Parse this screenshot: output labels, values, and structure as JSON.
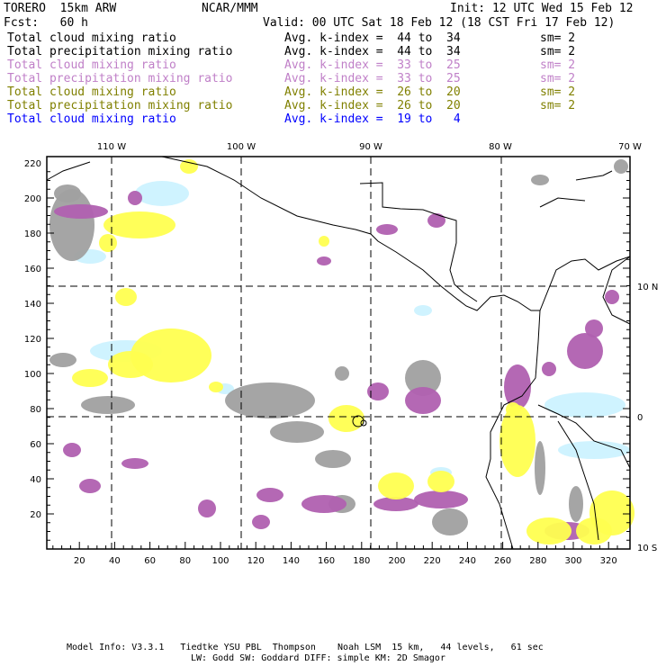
{
  "header": {
    "model": "TORERO  15km ARW",
    "org": "NCAR/MMM",
    "init": "Init: 12 UTC Wed 15 Feb 12",
    "fcst": "Fcst:   60 h",
    "valid": "Valid: 00 UTC Sat 18 Feb 12 (18 CST Fri 17 Feb 12)"
  },
  "legend": [
    {
      "field": "Total cloud mixing ratio",
      "range": "Avg. k-index =  44 to  34",
      "sm": "sm= 2",
      "color": "#000000"
    },
    {
      "field": "Total precipitation mixing ratio",
      "range": "Avg. k-index =  44 to  34",
      "sm": "sm= 2",
      "color": "#000000"
    },
    {
      "field": "Total cloud mixing ratio",
      "range": "Avg. k-index =  33 to  25",
      "sm": "sm= 2",
      "color": "#c080c8"
    },
    {
      "field": "Total precipitation mixing ratio",
      "range": "Avg. k-index =  33 to  25",
      "sm": "sm= 2",
      "color": "#c080c8"
    },
    {
      "field": "Total cloud mixing ratio",
      "range": "Avg. k-index =  26 to  20",
      "sm": "sm= 2",
      "color": "#808000"
    },
    {
      "field": "Total precipitation mixing ratio",
      "range": "Avg. k-index =  26 to  20",
      "sm": "sm= 2",
      "color": "#808000"
    },
    {
      "field": "Total cloud mixing ratio",
      "range": "Avg. k-index =  19 to   4",
      "sm": "",
      "color": "#0000ff"
    }
  ],
  "map": {
    "lon_labels": [
      "110 W",
      "100 W",
      "90 W",
      "80 W",
      "70 W"
    ],
    "lat_labels": [
      "10 N",
      "0",
      "10 S"
    ],
    "x_ticks": [
      "20",
      "40",
      "60",
      "80",
      "100",
      "120",
      "140",
      "160",
      "180",
      "200",
      "220",
      "240",
      "260",
      "280",
      "300",
      "320"
    ],
    "y_ticks": [
      "20",
      "40",
      "60",
      "80",
      "100",
      "120",
      "140",
      "160",
      "180",
      "200",
      "220"
    ],
    "colors": {
      "gray": "#a0a0a0",
      "magenta": "#b060b0",
      "yellow": "#ffff50",
      "lightblue": "#ccf2ff"
    }
  },
  "footer": {
    "line1": "Model Info: V3.3.1   Tiedtke YSU PBL  Thompson    Noah LSM  15 km,   44 levels,   61 sec",
    "line2": "LW: Godd SW: Goddard DIFF: simple KM: 2D Smagor"
  }
}
